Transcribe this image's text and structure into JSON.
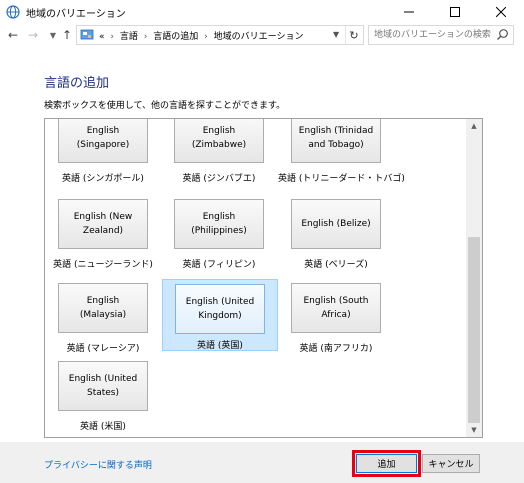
{
  "window": {
    "title": "地域のバリエーション"
  },
  "address": {
    "prefix": "«",
    "crumbs": [
      "言語",
      "言語の追加",
      "地域のバリエーション"
    ],
    "separator": "›"
  },
  "search": {
    "placeholder": "地域のバリエーションの検索"
  },
  "page": {
    "heading": "言語の追加",
    "instruction": "検索ボックスを使用して、他の言語を探すことができます。"
  },
  "tiles": [
    {
      "name": "English (Singapore)",
      "label": "英語 (シンガポール)",
      "selected": false
    },
    {
      "name": "English (Zimbabwe)",
      "label": "英語 (ジンバブエ)",
      "selected": false
    },
    {
      "name": "English (Trinidad and Tobago)",
      "label": "英語 (トリニーダード・トバゴ)",
      "selected": false
    },
    {
      "name": "English (New Zealand)",
      "label": "英語 (ニュージーランド)",
      "selected": false
    },
    {
      "name": "English (Philippines)",
      "label": "英語 (フィリピン)",
      "selected": false
    },
    {
      "name": "English (Belize)",
      "label": "英語 (ベリーズ)",
      "selected": false
    },
    {
      "name": "English (Malaysia)",
      "label": "英語 (マレーシア)",
      "selected": false
    },
    {
      "name": "English (United Kingdom)",
      "label": "英語 (英国)",
      "selected": true
    },
    {
      "name": "English (South Africa)",
      "label": "英語 (南アフリカ)",
      "selected": false
    },
    {
      "name": "English (United States)",
      "label": "英語 (米国)",
      "selected": false
    }
  ],
  "footer": {
    "privacy_link": "プライバシーに関する声明",
    "add_label": "追加",
    "cancel_label": "キャンセル"
  },
  "colors": {
    "heading": "#1e3287",
    "link": "#0066cc",
    "highlight": "#e60012",
    "selection": "#cce8ff"
  }
}
